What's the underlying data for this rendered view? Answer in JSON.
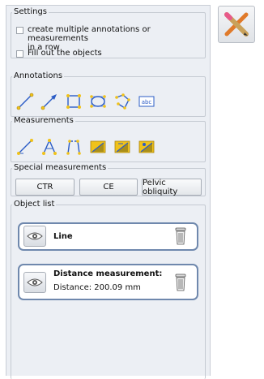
{
  "settings": {
    "legend": "Settings",
    "options": [
      {
        "label_line1": "create multiple annotations or measurements",
        "label_line2": "in a row",
        "checked": false
      },
      {
        "label": "Fill out the objects",
        "checked": false
      }
    ]
  },
  "annotations": {
    "legend": "Annotations",
    "tools": [
      "line-tool-icon",
      "arrow-tool-icon",
      "rectangle-tool-icon",
      "ellipse-tool-icon",
      "polygon-tool-icon",
      "text-tool-icon"
    ],
    "text_tool_label": "abc"
  },
  "measurements": {
    "legend": "Measurements",
    "tools": [
      "distance-measure-icon",
      "angle-measure-icon",
      "cobb-angle-icon",
      "area-ruler-icon",
      "area-ruler-plus-icon",
      "area-ruler-alt-icon"
    ]
  },
  "special": {
    "legend": "Special measurements",
    "buttons": [
      "CTR",
      "CE",
      "Pelvic obliquity"
    ]
  },
  "object_list": {
    "legend": "Object list",
    "items": [
      {
        "title": "Line",
        "subtitle": ""
      },
      {
        "title": "Distance measurement:",
        "subtitle": "Distance: 200.09 mm"
      }
    ]
  },
  "toolbar": {
    "close_icon": "pencil-cross-icon"
  },
  "colors": {
    "tool_blue": "#2b5cc6",
    "tool_yellow": "#f0c21a",
    "object_border": "#6f88ad"
  }
}
